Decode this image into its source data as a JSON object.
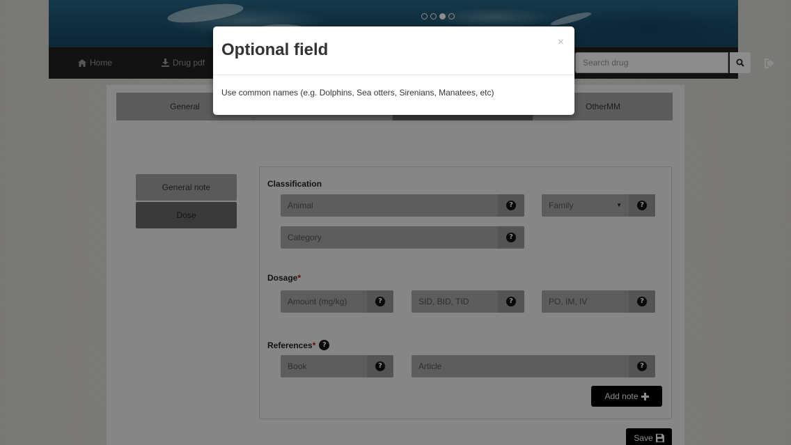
{
  "carousel": {
    "slide_count": 4,
    "active_index": 2
  },
  "navbar": {
    "home_label": "Home",
    "drug_pdf_label": "Drug pdf",
    "search_placeholder": "Search drug"
  },
  "tabs": [
    {
      "label": "General",
      "active": false
    },
    {
      "label": "",
      "active": false
    },
    {
      "label": "",
      "active": true
    },
    {
      "label": "OtherMM",
      "active": false
    }
  ],
  "sidebar": {
    "items": [
      {
        "label": "General note",
        "active": false
      },
      {
        "label": "Dose",
        "active": true
      }
    ]
  },
  "form": {
    "classification": {
      "label": "Classification",
      "animal_placeholder": "Animal",
      "family_selected": "Family",
      "category_placeholder": "Category"
    },
    "dosage": {
      "label": "Dosage",
      "required_mark": "*",
      "amount_placeholder": "Amount (mg/kg)",
      "frequency_placeholder": "SID, BID, TID",
      "route_placeholder": "PO, IM, IV"
    },
    "references": {
      "label": "References",
      "required_mark": "*",
      "book_placeholder": "Book",
      "article_placeholder": "Article"
    },
    "add_note_label": "Add note",
    "save_label": "Save"
  },
  "modal": {
    "title": "Optional field",
    "close_glyph": "×",
    "body": "Use common names (e.g. Dolphins, Sea otters, Sirenians, Manatees, etc)"
  },
  "colors": {
    "overlay": "#000000",
    "navbar": "#222222",
    "required": "#cc0000"
  }
}
